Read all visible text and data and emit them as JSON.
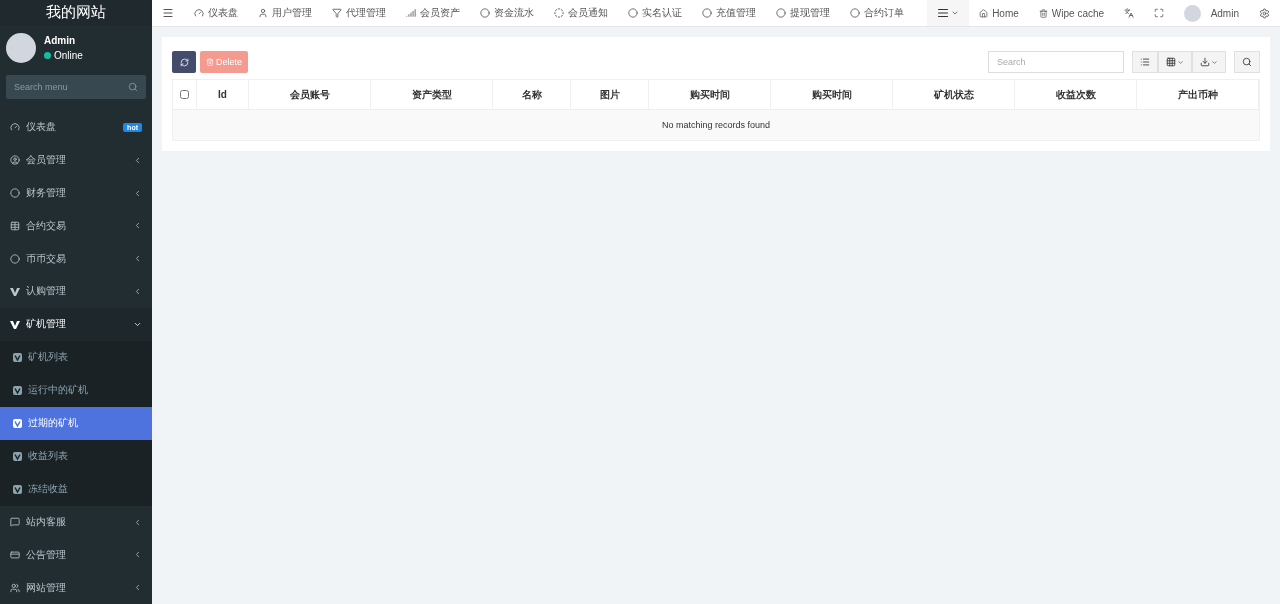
{
  "brand": "我的网站",
  "user": {
    "name": "Admin",
    "status": "Online"
  },
  "sidebar_search": {
    "placeholder": "Search menu"
  },
  "menu": [
    {
      "label": "仪表盘",
      "badge": "hot",
      "expanded": false
    },
    {
      "label": "会员管理",
      "expanded": false
    },
    {
      "label": "财务管理",
      "expanded": false
    },
    {
      "label": "合约交易",
      "expanded": false
    },
    {
      "label": "币币交易",
      "expanded": false
    },
    {
      "label": "认购管理",
      "expanded": false
    },
    {
      "label": "矿机管理",
      "expanded": true,
      "children": [
        {
          "label": "矿机列表",
          "selected": false
        },
        {
          "label": "运行中的矿机",
          "selected": false
        },
        {
          "label": "过期的矿机",
          "selected": true
        },
        {
          "label": "收益列表",
          "selected": false
        },
        {
          "label": "冻结收益",
          "selected": false
        }
      ]
    },
    {
      "label": "站内客服",
      "expanded": false
    },
    {
      "label": "公告管理",
      "expanded": false
    },
    {
      "label": "网站管理",
      "expanded": false
    }
  ],
  "top_nav": [
    "仪表盘",
    "用户管理",
    "代理管理",
    "会员资产",
    "资金流水",
    "会员通知",
    "实名认证",
    "充值管理",
    "提现管理",
    "合约订单"
  ],
  "top_right": {
    "home": "Home",
    "wipe_cache": "Wipe cache",
    "user": "Admin"
  },
  "toolbar": {
    "delete": "Delete",
    "search_placeholder": "Search"
  },
  "table": {
    "select_all_checked": false,
    "columns": [
      "Id",
      "会员账号",
      "资产类型",
      "名称",
      "图片",
      "购买时间",
      "购买时间",
      "矿机状态",
      "收益次数",
      "产出币种"
    ],
    "empty_message": "No matching records found"
  }
}
